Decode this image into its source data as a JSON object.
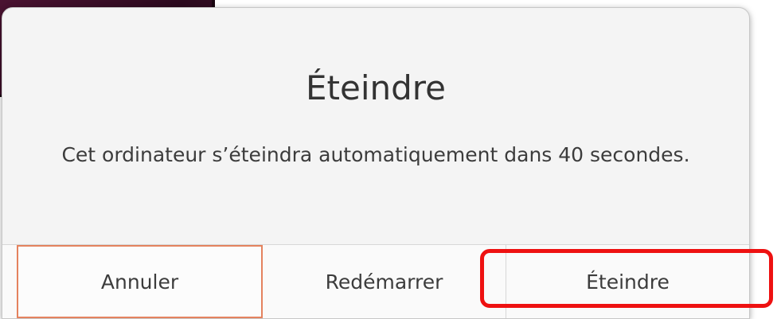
{
  "dialog": {
    "title": "Éteindre",
    "message": "Cet ordinateur s’éteindra automatiquement dans 40 secondes."
  },
  "buttons": {
    "cancel": "Annuler",
    "restart": "Redémarrer",
    "shutdown": "Éteindre"
  },
  "annotation": {
    "highlight_color": "#ee1111"
  },
  "colors": {
    "focus_border": "#e4825e",
    "desktop_background": "#3a0f28"
  }
}
